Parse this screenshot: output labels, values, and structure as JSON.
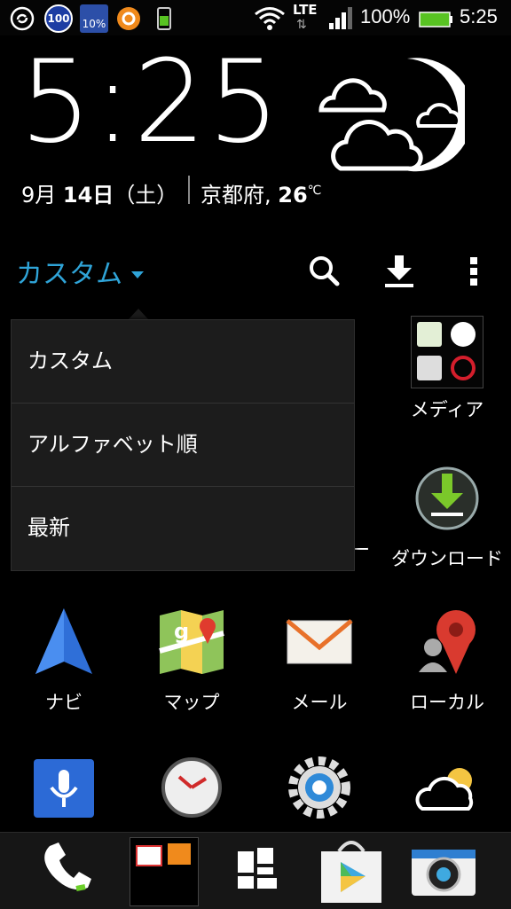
{
  "status_bar": {
    "battery_percent": "100%",
    "time": "5:25",
    "network": "LTE",
    "notif_badge": "100",
    "notif_weather": "10%",
    "icons": [
      "sync-icon",
      "badge-100-icon",
      "weather-notif-icon",
      "orange-app-icon",
      "phone-icon",
      "wifi-icon",
      "lte-icon",
      "signal-icon",
      "battery-icon"
    ]
  },
  "clock_widget": {
    "time": "5:25",
    "date_month": "9月 ",
    "date_day": "14日",
    "date_weekday": "（土）",
    "location": "京都府, ",
    "temperature": "26",
    "temp_unit": "℃",
    "weather_icon": "night-cloudy-icon"
  },
  "toolbar": {
    "sort_label": "カスタム",
    "icons": [
      "search-icon",
      "download-icon",
      "more-icon"
    ]
  },
  "sort_menu": {
    "items": [
      {
        "label": "カスタム"
      },
      {
        "label": "アルファベット順"
      },
      {
        "label": "最新"
      }
    ]
  },
  "apps": {
    "media_label": "メディア",
    "download_label": "ダウンロード",
    "partial_label": "ー",
    "row3": [
      {
        "label": "ナビ",
        "icon": "navigation-icon"
      },
      {
        "label": "マップ",
        "icon": "maps-icon"
      },
      {
        "label": "メール",
        "icon": "mail-icon"
      },
      {
        "label": "ローカル",
        "icon": "local-icon"
      }
    ],
    "row4": [
      {
        "icon": "voice-search-icon"
      },
      {
        "icon": "clock-icon"
      },
      {
        "icon": "settings-icon"
      },
      {
        "icon": "weather-icon"
      }
    ]
  },
  "dock": {
    "icons": [
      "phone-icon",
      "mail-folder-icon",
      "apps-icon",
      "play-store-icon",
      "camera-icon"
    ]
  },
  "colors": {
    "accent": "#2fa4d8",
    "menu_bg": "#1c1c1c",
    "battery": "#58c322"
  }
}
